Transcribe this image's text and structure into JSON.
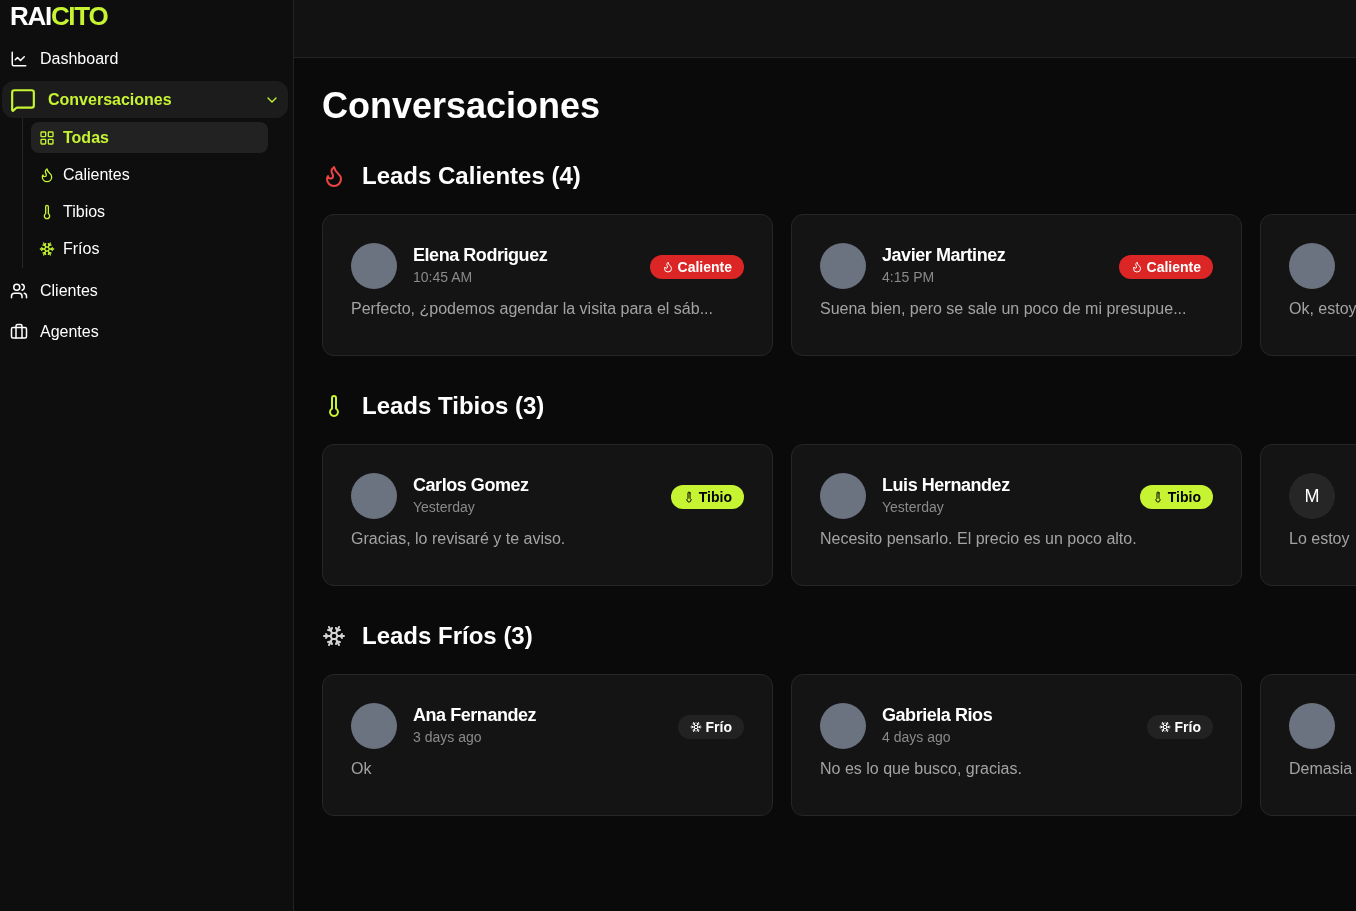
{
  "logo": {
    "part_1": "RAI",
    "part_2": "CITO"
  },
  "sidebar": {
    "items": [
      {
        "label": "Dashboard",
        "selected": false
      },
      {
        "label": "Conversaciones",
        "selected": true,
        "expanded": true,
        "children": [
          {
            "label": "Todas",
            "selected": true
          },
          {
            "label": "Calientes",
            "selected": false
          },
          {
            "label": "Tibios",
            "selected": false
          },
          {
            "label": "Fríos",
            "selected": false
          }
        ]
      },
      {
        "label": "Clientes",
        "selected": false
      },
      {
        "label": "Agentes",
        "selected": false
      }
    ]
  },
  "page_title": "Conversaciones",
  "sections": [
    {
      "kind": "hot",
      "title": "Leads Calientes (4)",
      "cards": [
        {
          "kind": "photo",
          "name": "Elena Rodriguez",
          "time": "10:45 AM",
          "badge": "Caliente",
          "message": "Perfecto, ¿podemos agendar la visita para el sáb..."
        },
        {
          "kind": "photo",
          "name": "Javier Martinez",
          "time": "4:15 PM",
          "badge": "Caliente",
          "message": "Suena bien, pero se sale un poco de mi presupue..."
        },
        {
          "kind": "photo",
          "message": "Ok, estoy"
        }
      ]
    },
    {
      "kind": "warm",
      "title": "Leads Tibios (3)",
      "cards": [
        {
          "kind": "photo",
          "name": "Carlos Gomez",
          "time": "Yesterday",
          "badge": "Tibio",
          "message": "Gracias, lo revisaré y te aviso."
        },
        {
          "kind": "photo",
          "name": "Luis Hernandez",
          "time": "Yesterday",
          "badge": "Tibio",
          "message": "Necesito pensarlo. El precio es un poco alto."
        },
        {
          "kind": "initial",
          "initial": "M",
          "message": "Lo estoy"
        }
      ]
    },
    {
      "kind": "cold",
      "title": "Leads Fríos (3)",
      "cards": [
        {
          "kind": "photo",
          "name": "Ana Fernandez",
          "time": "3 days ago",
          "badge": "Frío",
          "message": "Ok"
        },
        {
          "kind": "photo",
          "name": "Gabriela Rios",
          "time": "4 days ago",
          "badge": "Frío",
          "message": "No es lo que busco, gracias."
        },
        {
          "kind": "photo",
          "message": "Demasia"
        }
      ]
    }
  ]
}
